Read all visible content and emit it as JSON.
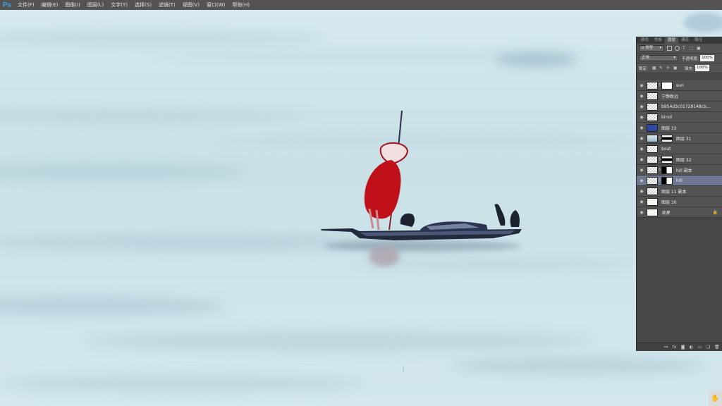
{
  "app": {
    "logo": "Ps"
  },
  "menu": [
    "文件(F)",
    "编辑(E)",
    "图像(I)",
    "图层(L)",
    "文字(Y)",
    "选择(S)",
    "滤镜(T)",
    "视图(V)",
    "窗口(W)",
    "帮助(H)"
  ],
  "panel": {
    "tabs": [
      "颜色",
      "色板",
      "图层",
      "通道",
      "路径"
    ],
    "active_tab": 2,
    "filter_select": "ρ 类型",
    "blend_mode": "正常",
    "opacity_label": "不透明度:",
    "opacity_value": "100%",
    "lock_label": "锁定:",
    "fill_label": "填充:",
    "fill_value": "100%"
  },
  "layers": [
    {
      "name": "sun",
      "thumb": "checker",
      "mask": "plain"
    },
    {
      "name": "宁静致远",
      "thumb": "checker"
    },
    {
      "name": "b954d3c01729148cb78b...",
      "thumb": "checker"
    },
    {
      "name": "birsd",
      "thumb": "checker"
    },
    {
      "name": "图层 33",
      "thumb": "blue"
    },
    {
      "name": "图层 31",
      "thumb": "scene",
      "mask": "strip"
    },
    {
      "name": "boat",
      "thumb": "checker"
    },
    {
      "name": "图层 32",
      "thumb": "checker",
      "mask": "strip"
    },
    {
      "name": "hill 副本",
      "thumb": "checker",
      "mask": "half"
    },
    {
      "name": "hill",
      "thumb": "checker",
      "mask": "half",
      "selected": true
    },
    {
      "name": "图层 11 副本",
      "thumb": "checker"
    },
    {
      "name": "图层 30",
      "thumb": "plain"
    },
    {
      "name": "背景",
      "thumb": "plain",
      "locked": true
    }
  ],
  "colors": {
    "accent": "#c0101a",
    "panel_bg": "#535353",
    "menubar_bg": "#535353"
  }
}
